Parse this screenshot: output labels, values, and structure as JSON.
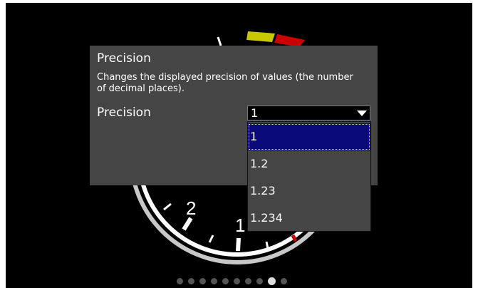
{
  "gauge": {
    "tick_labels": [
      "2",
      "1"
    ]
  },
  "dialog": {
    "title": "Precision",
    "description": "Changes the displayed precision of values (the number of decimal places).",
    "field_label": "Precision",
    "select": {
      "value": "1",
      "options": [
        "1",
        "1.2",
        "1.23",
        "1.234"
      ],
      "selected_index": 0
    }
  },
  "pager": {
    "total": 10,
    "active_index": 8
  },
  "colors": {
    "background": "#000000",
    "dialog": "#454545",
    "selected_option": "#0a0a7a",
    "gauge_yellow": "#c8c800",
    "gauge_red": "#cc0000"
  }
}
